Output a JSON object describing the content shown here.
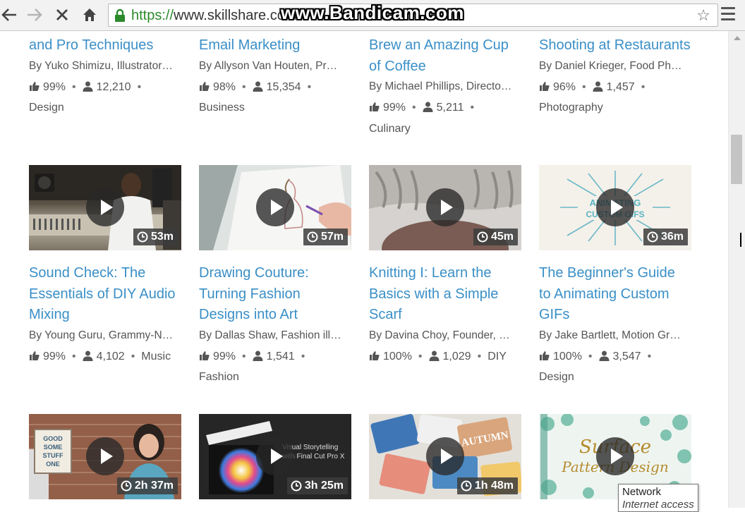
{
  "browser": {
    "url_scheme": "https://",
    "url_host": "www.skillshare.com",
    "watermark": "www.Bandicam.com"
  },
  "tooltip": {
    "title": "Network",
    "subtitle": "Internet access"
  },
  "row1": [
    {
      "title": [
        "and Pro Techniques"
      ],
      "author": "By Yuko Shimizu, Illustrator…",
      "rating": "99%",
      "students": "12,210",
      "category": "Design"
    },
    {
      "title": [
        "Email Marketing"
      ],
      "author": "By Allyson Van Houten, Pr…",
      "rating": "98%",
      "students": "15,354",
      "category": "Business"
    },
    {
      "title": [
        "Brew an Amazing Cup",
        "of Coffee"
      ],
      "author": "By Michael Phillips, Directo…",
      "rating": "99%",
      "students": "5,211",
      "category": "Culinary"
    },
    {
      "title": [
        "Shooting at Restaurants"
      ],
      "author": "By Daniel Krieger, Food Ph…",
      "rating": "96%",
      "students": "1,457",
      "category": "Photography"
    }
  ],
  "row2": [
    {
      "duration": "53m",
      "title": [
        "Sound Check: The",
        "Essentials of DIY Audio",
        "Mixing"
      ],
      "author": "By Young Guru, Grammy-N…",
      "rating": "99%",
      "students": "4,102",
      "category": "Music"
    },
    {
      "duration": "57m",
      "title": [
        "Drawing Couture:",
        "Turning Fashion",
        "Designs into Art"
      ],
      "author": "By Dallas Shaw, Fashion ill…",
      "rating": "99%",
      "students": "1,541",
      "category": "Fashion"
    },
    {
      "duration": "45m",
      "title": [
        "Knitting I: Learn the",
        "Basics with a Simple",
        "Scarf"
      ],
      "author": "By Davina Choy, Founder, …",
      "rating": "100%",
      "students": "1,029",
      "category": "DIY"
    },
    {
      "duration": "36m",
      "title": [
        "The Beginner's Guide",
        "to Animating Custom",
        "GIFs"
      ],
      "author": "By Jake Bartlett, Motion Gr…",
      "rating": "100%",
      "students": "3,547",
      "category": "Design",
      "thumb_text": [
        "ANIMATING",
        "CUSTOM GIFS"
      ]
    }
  ],
  "row3": [
    {
      "duration": "2h 37m",
      "thumb_text": [
        "GOOD",
        "SOME",
        "STUFF",
        "ONE"
      ]
    },
    {
      "duration": "3h 25m",
      "thumb_text": [
        "Visual Storytelling",
        "with Final Cut Pro X"
      ]
    },
    {
      "duration": "1h 48m",
      "thumb_text": [
        "AUTUMN"
      ]
    },
    {
      "duration": "",
      "thumb_text": [
        "Surface",
        "Pattern Design"
      ]
    }
  ],
  "colors": {
    "link": "#3a8fc7",
    "text": "#555555",
    "secure": "#2b8a2b"
  }
}
